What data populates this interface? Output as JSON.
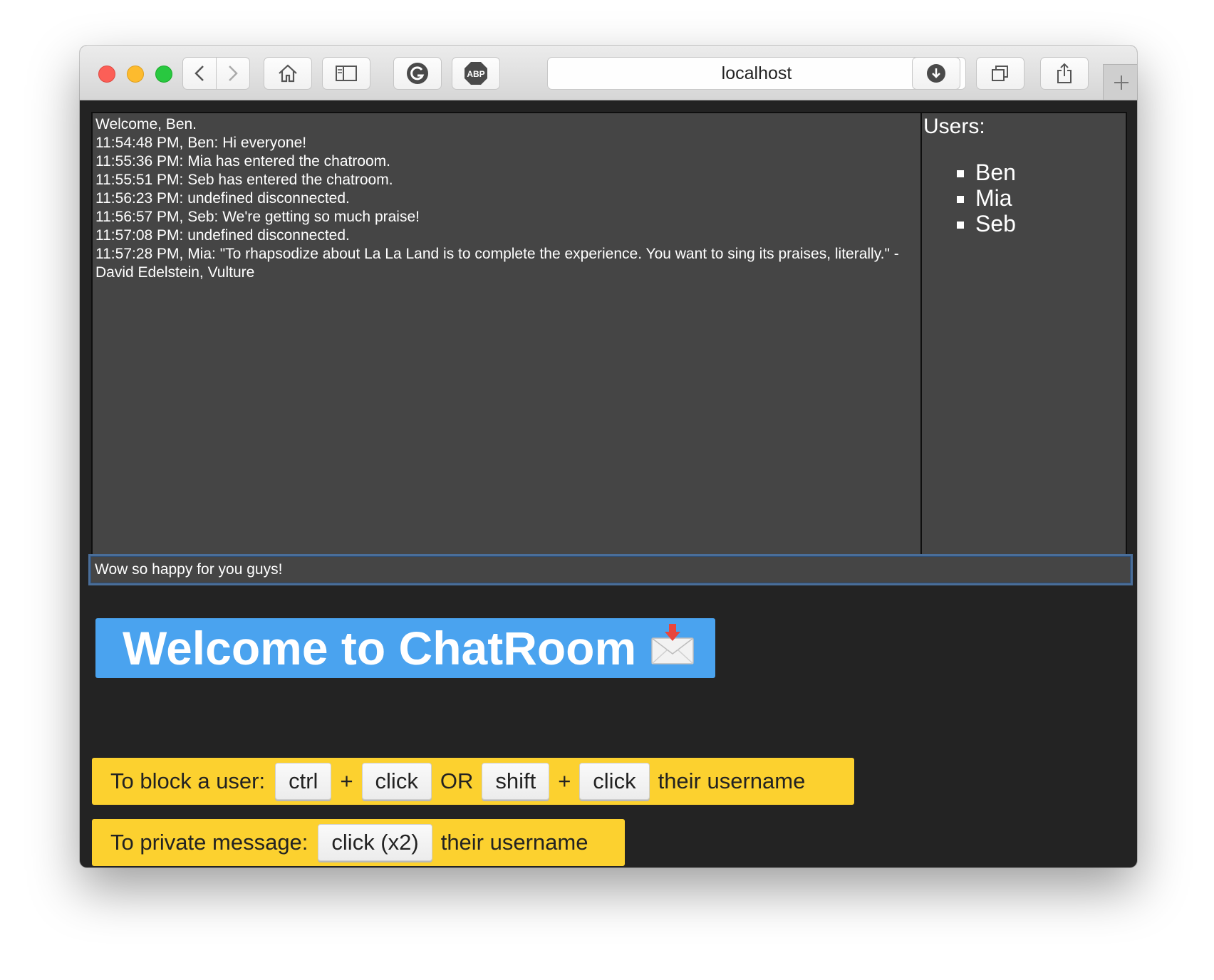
{
  "browser": {
    "url": "localhost",
    "buttons": [
      "back-icon",
      "forward-icon",
      "home-icon",
      "sidebar-icon",
      "grammarly-icon",
      "adblock-icon",
      "reload-icon",
      "download-icon",
      "tabs-icon",
      "share-icon",
      "plus-icon"
    ],
    "adblock_label": "ABP"
  },
  "chat": {
    "messages": [
      "Welcome, Ben.",
      "11:54:48 PM, Ben: Hi everyone!",
      "11:55:36 PM: Mia has entered the chatroom.",
      "11:55:51 PM: Seb has entered the chatroom.",
      "11:56:23 PM: undefined disconnected.",
      "11:56:57 PM, Seb: We're getting so much praise!",
      "11:57:08 PM: undefined disconnected.",
      "11:57:28 PM, Mia: \"To rhapsodize about La La Land is to complete the experience. You want to sing its praises, literally.\" - David Edelstein, Vulture"
    ],
    "input_value": "Wow so happy for you guys!"
  },
  "users": {
    "title": "Users:",
    "list": [
      "Ben",
      "Mia",
      "Seb"
    ]
  },
  "banner": {
    "text": "Welcome to ChatRoom",
    "icon": "envelope-with-arrow-icon"
  },
  "tips": {
    "block": {
      "label": "To block a user:",
      "key1": "ctrl",
      "plus1": "+",
      "key2": "click",
      "or": "OR",
      "key3": "shift",
      "plus2": "+",
      "key4": "click",
      "suffix": "their username"
    },
    "private": {
      "label": "To private message:",
      "key1": "click (x2)",
      "suffix": "their username"
    }
  },
  "colors": {
    "page_bg": "#232323",
    "panel_bg": "#454545",
    "banner_bg": "#4aa3ef",
    "tip_bg": "#fcd12f",
    "input_border": "#4a6e99"
  }
}
